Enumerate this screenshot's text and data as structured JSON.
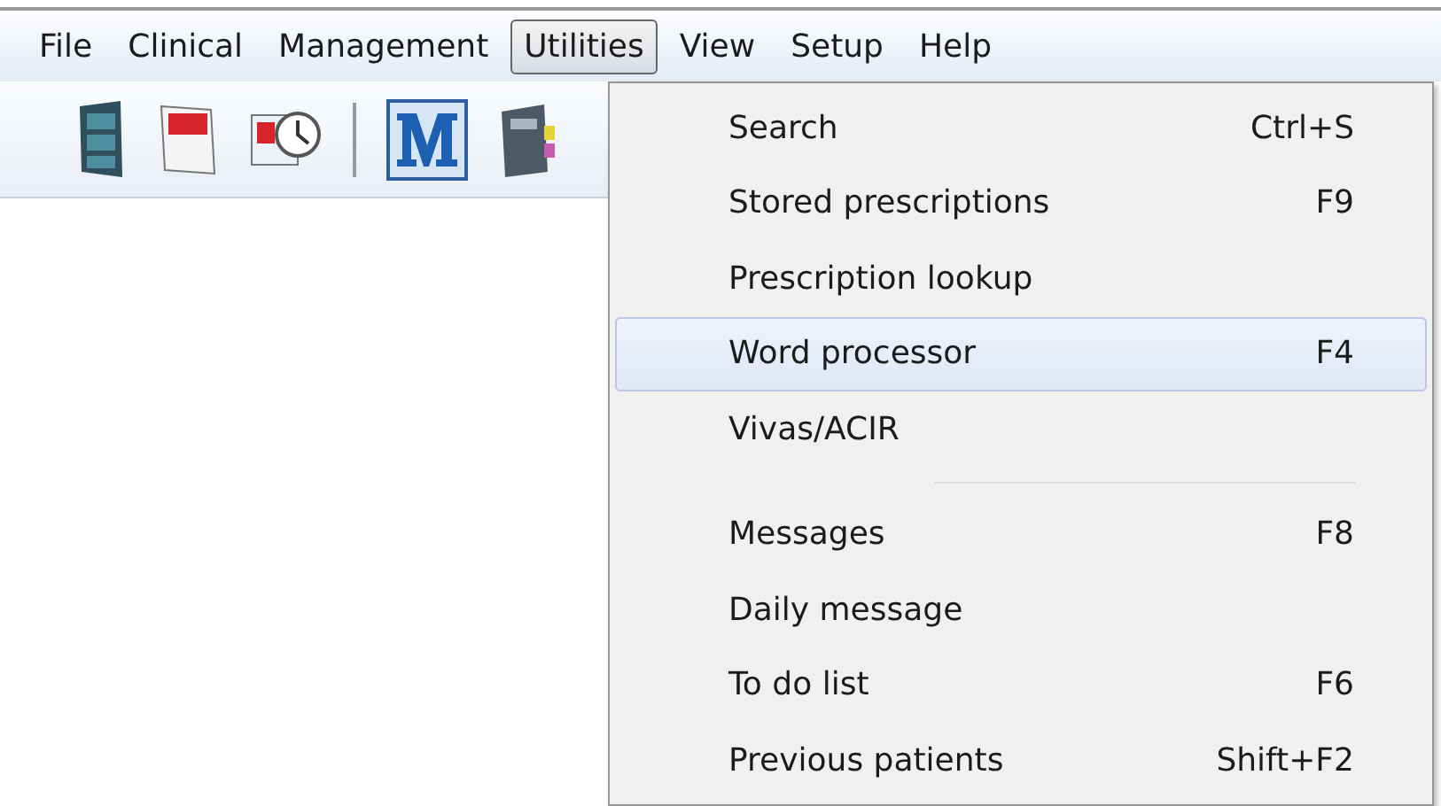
{
  "menu_bar": [
    {
      "label": "File",
      "selected": false
    },
    {
      "label": "Clinical",
      "selected": false
    },
    {
      "label": "Management",
      "selected": false
    },
    {
      "label": "Utilities",
      "selected": true
    },
    {
      "label": "View",
      "selected": false
    },
    {
      "label": "Setup",
      "selected": false
    },
    {
      "label": "Help",
      "selected": false
    }
  ],
  "dropdown": [
    {
      "kind": "item",
      "label": "Search",
      "shortcut": "Ctrl+S",
      "selected": false
    },
    {
      "kind": "item",
      "label": "Stored prescriptions",
      "shortcut": "F9",
      "selected": false
    },
    {
      "kind": "item",
      "label": "Prescription lookup",
      "selected": false
    },
    {
      "kind": "item",
      "label": "Word processor",
      "shortcut": "F4",
      "selected": true
    },
    {
      "kind": "item",
      "label": "Vivas/ACIR",
      "selected": false
    },
    {
      "kind": "separator"
    },
    {
      "kind": "item",
      "label": "Messages",
      "shortcut": "F8",
      "selected": false
    },
    {
      "kind": "item",
      "label": "Daily message",
      "selected": false
    },
    {
      "kind": "item",
      "label": "To do list",
      "shortcut": "F6",
      "selected": false
    },
    {
      "kind": "item",
      "label": "Previous patients",
      "shortcut": "Shift+F2",
      "selected": false
    }
  ]
}
